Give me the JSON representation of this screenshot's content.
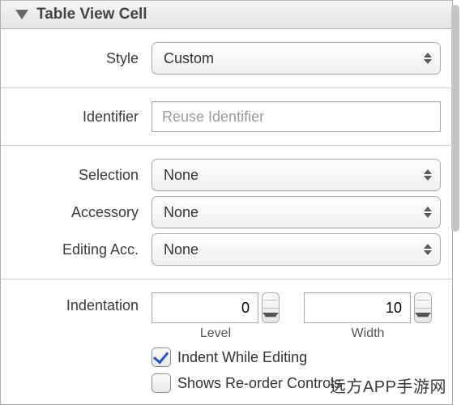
{
  "header": {
    "title": "Table View Cell"
  },
  "style": {
    "label": "Style",
    "value": "Custom"
  },
  "identifier": {
    "label": "Identifier",
    "placeholder": "Reuse Identifier",
    "value": ""
  },
  "selection": {
    "label": "Selection",
    "value": "None"
  },
  "accessory": {
    "label": "Accessory",
    "value": "None"
  },
  "editingAcc": {
    "label": "Editing Acc.",
    "value": "None"
  },
  "indentation": {
    "label": "Indentation",
    "level": {
      "value": "0",
      "sublabel": "Level"
    },
    "width": {
      "value": "10",
      "sublabel": "Width"
    },
    "indentWhileEditing": {
      "label": "Indent While Editing",
      "checked": true
    },
    "showsReorder": {
      "label": "Shows Re-order Controls",
      "checked": false
    }
  },
  "watermark": "远方APP手游网"
}
